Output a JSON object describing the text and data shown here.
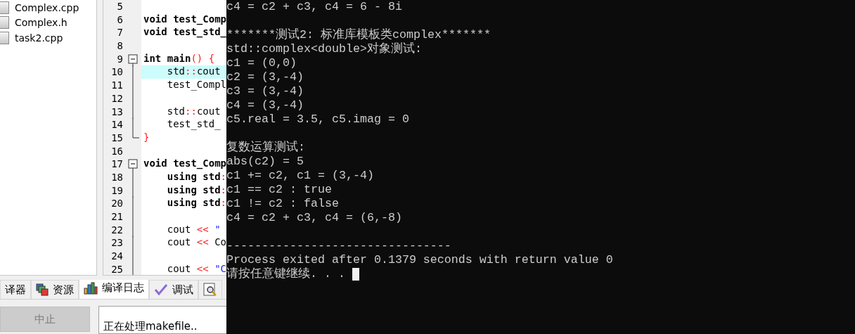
{
  "project_tree": {
    "files": [
      {
        "label": "Complex.cpp"
      },
      {
        "label": "Complex.h"
      },
      {
        "label": "task2.cpp"
      }
    ]
  },
  "editor": {
    "lines": [
      {
        "number": "5",
        "kind": "plain",
        "highlighted": false
      },
      {
        "number": "6",
        "kind": "plain",
        "highlighted": false,
        "segments": [
          {
            "text": "void test_Comp",
            "kind": "keyword"
          }
        ]
      },
      {
        "number": "7",
        "kind": "plain",
        "highlighted": false,
        "segments": [
          {
            "text": "void test_std_",
            "kind": "keyword"
          }
        ]
      },
      {
        "number": "8",
        "kind": "plain",
        "highlighted": false
      },
      {
        "number": "9",
        "kind": "foldstart",
        "highlighted": false,
        "segments": [
          {
            "text": "int main",
            "kind": "keyword"
          },
          {
            "text": "() {",
            "kind": "operator"
          }
        ]
      },
      {
        "number": "10",
        "kind": "folded",
        "highlighted": true,
        "segments": [
          {
            "text": "    std",
            "kind": "plain"
          },
          {
            "text": "::",
            "kind": "operator"
          },
          {
            "text": "cout",
            "kind": "plain"
          }
        ]
      },
      {
        "number": "11",
        "kind": "folded",
        "highlighted": false,
        "segments": [
          {
            "text": "    test_Compl",
            "kind": "plain"
          }
        ]
      },
      {
        "number": "12",
        "kind": "folded",
        "highlighted": false
      },
      {
        "number": "13",
        "kind": "folded",
        "highlighted": false,
        "segments": [
          {
            "text": "    std",
            "kind": "plain"
          },
          {
            "text": "::",
            "kind": "operator"
          },
          {
            "text": "cout",
            "kind": "plain"
          }
        ]
      },
      {
        "number": "14",
        "kind": "folded",
        "highlighted": false,
        "segments": [
          {
            "text": "    test_std_",
            "kind": "plain"
          }
        ]
      },
      {
        "number": "15",
        "kind": "foldend",
        "highlighted": false,
        "segments": [
          {
            "text": "}",
            "kind": "operator"
          }
        ]
      },
      {
        "number": "16",
        "kind": "plain",
        "highlighted": false
      },
      {
        "number": "17",
        "kind": "foldstart",
        "highlighted": false,
        "segments": [
          {
            "text": "void test_Comp",
            "kind": "keyword"
          }
        ]
      },
      {
        "number": "18",
        "kind": "folded",
        "highlighted": false,
        "segments": [
          {
            "text": "    using std",
            "kind": "keyword"
          },
          {
            "text": ":",
            "kind": "operator"
          }
        ]
      },
      {
        "number": "19",
        "kind": "folded",
        "highlighted": false,
        "segments": [
          {
            "text": "    using std",
            "kind": "keyword"
          },
          {
            "text": ":",
            "kind": "operator"
          }
        ]
      },
      {
        "number": "20",
        "kind": "folded",
        "highlighted": false,
        "segments": [
          {
            "text": "    using std",
            "kind": "keyword"
          },
          {
            "text": ":",
            "kind": "operator"
          }
        ]
      },
      {
        "number": "21",
        "kind": "folded",
        "highlighted": false
      },
      {
        "number": "22",
        "kind": "folded",
        "highlighted": false,
        "segments": [
          {
            "text": "    cout ",
            "kind": "plain"
          },
          {
            "text": "<<",
            "kind": "operator"
          },
          {
            "text": " \"",
            "kind": "string"
          }
        ]
      },
      {
        "number": "23",
        "kind": "folded",
        "highlighted": false,
        "segments": [
          {
            "text": "    cout ",
            "kind": "plain"
          },
          {
            "text": "<<",
            "kind": "operator"
          },
          {
            "text": " Co",
            "kind": "plain"
          }
        ]
      },
      {
        "number": "24",
        "kind": "folded",
        "highlighted": false
      },
      {
        "number": "25",
        "kind": "folded",
        "highlighted": false,
        "segments": [
          {
            "text": "    cout ",
            "kind": "plain"
          },
          {
            "text": "<<",
            "kind": "operator"
          },
          {
            "text": " \"C",
            "kind": "string"
          }
        ]
      }
    ]
  },
  "bottom_tabs": [
    {
      "label": "译器",
      "selected": false
    },
    {
      "label": "资源",
      "selected": false
    },
    {
      "label": "编译日志",
      "selected": true
    },
    {
      "label": "调试",
      "selected": false
    },
    {
      "selected": false
    }
  ],
  "abort_button": {
    "label": "中止",
    "disabled": true
  },
  "compile_log": {
    "text": "正在处理makefile.."
  },
  "console": {
    "blocks": [
      [
        "c4 = c2 + c3, c4 = 6 - 8i"
      ],
      [
        "*******测试2: 标准库模板类complex*******",
        "std::complex<double>对象测试:",
        "c1 = (0,0)",
        "c2 = (3,-4)",
        "c3 = (3,-4)",
        "c4 = (3,-4)",
        "c5.real = 3.5, c5.imag = 0"
      ],
      [
        "复数运算测试:",
        "abs(c2) = 5",
        "c1 += c2, c1 = (3,-4)",
        "c1 == c2 : true",
        "c1 != c2 : false",
        "c4 = c2 + c3, c4 = (6,-8)"
      ],
      [
        "--------------------------------",
        "Process exited after 0.1379 seconds with return value 0",
        "请按任意键继续. . . "
      ]
    ],
    "cursor": true
  }
}
